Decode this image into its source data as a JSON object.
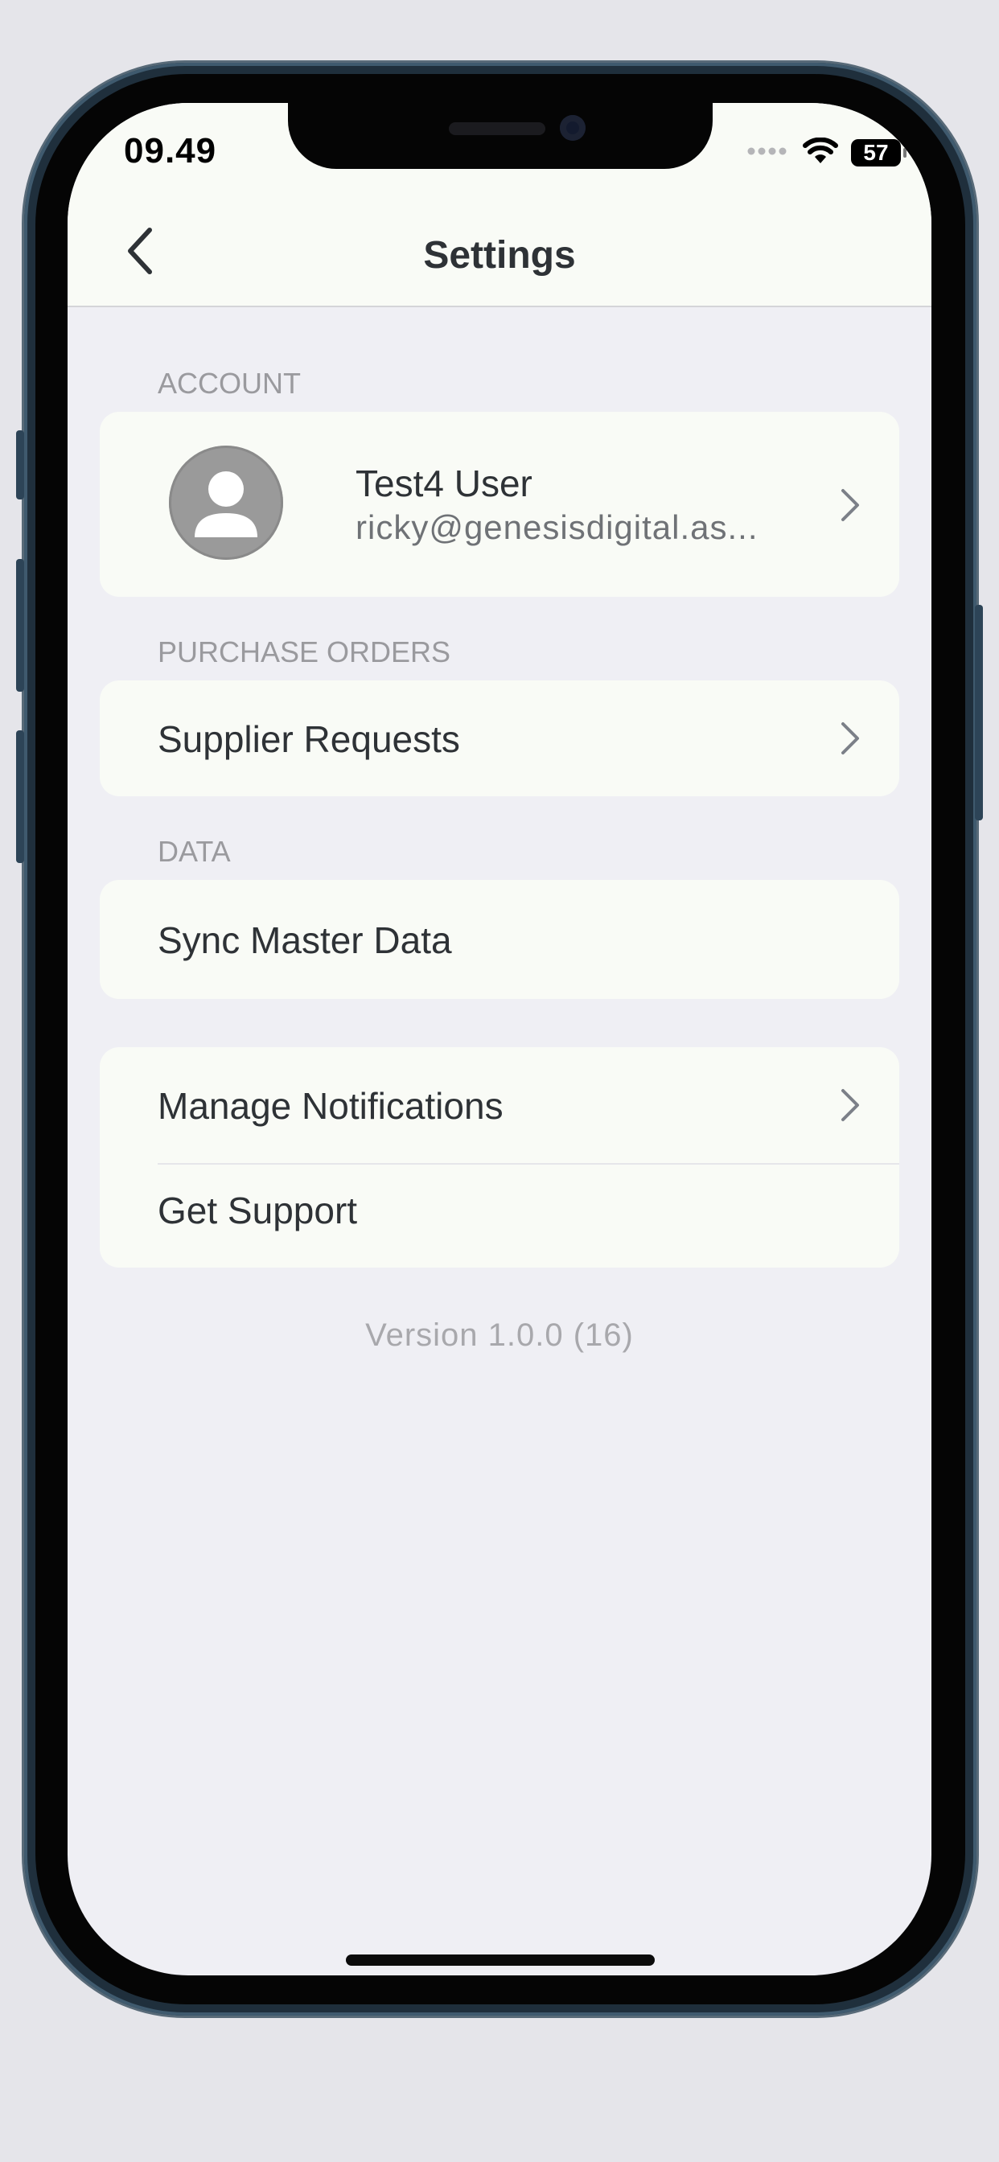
{
  "status_bar": {
    "time": "09.49",
    "battery_level": "57",
    "icons": [
      "cellular-signal-icon",
      "wifi-icon",
      "battery-icon"
    ]
  },
  "nav": {
    "title": "Settings",
    "back_icon": "chevron-left-icon"
  },
  "sections": {
    "account": {
      "header": "ACCOUNT",
      "user_name": "Test4 User",
      "user_email": "ricky@genesisdigital.as..."
    },
    "purchase_orders": {
      "header": "PURCHASE ORDERS",
      "items": [
        {
          "label": "Supplier Requests"
        }
      ]
    },
    "data": {
      "header": "DATA",
      "items": [
        {
          "label": "Sync Master Data"
        }
      ]
    },
    "other": {
      "items": [
        {
          "label": "Manage Notifications"
        },
        {
          "label": "Get Support"
        }
      ]
    }
  },
  "footer": {
    "version": "Version 1.0.0 (16)"
  },
  "colors": {
    "background": "#efeff4",
    "card": "#f9fbf6",
    "text_primary": "#2e3236",
    "text_secondary": "#9a9a9e",
    "chevron": "#7c8088",
    "phone_frame": "#1f2f3c"
  }
}
